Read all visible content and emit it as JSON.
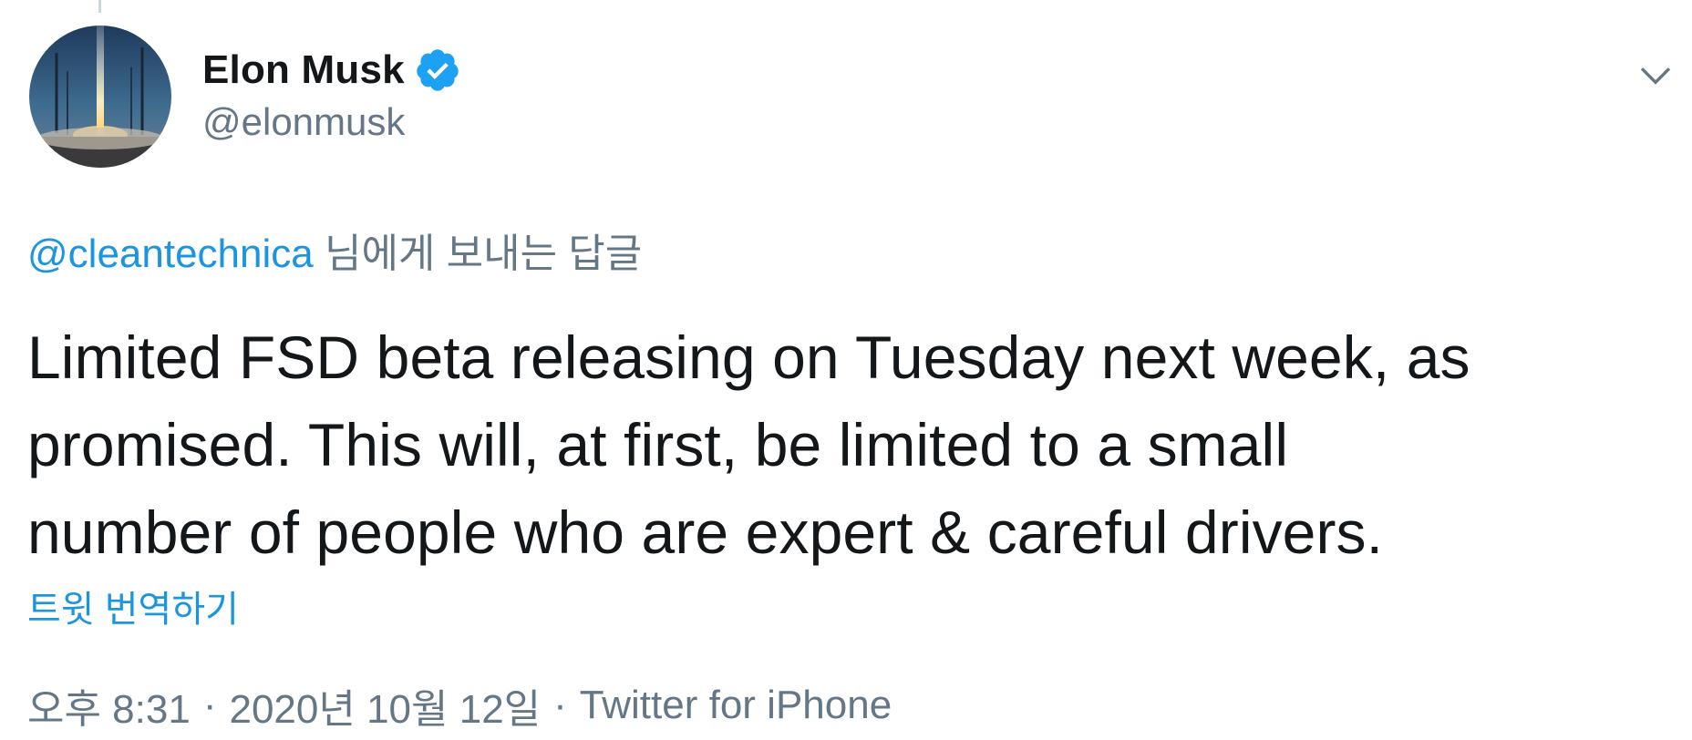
{
  "author": {
    "display_name": "Elon Musk",
    "handle": "@elonmusk",
    "verified": true,
    "avatar_icon": "rocket-launch-avatar"
  },
  "menu": {
    "icon": "chevron-down-icon"
  },
  "reply_context": {
    "mention": "@cleantechnica",
    "suffix": " 님에게 보내는 답글"
  },
  "tweet": {
    "lines": [
      "Limited FSD beta releasing on Tuesday next week, as",
      "promised. This will, at first, be limited to a small",
      "number of people who are expert & careful drivers."
    ],
    "translate_label": "트윗 번역하기"
  },
  "meta": {
    "time": "오후 8:31",
    "separator": "·",
    "date": "2020년 10월 12일",
    "source": "Twitter for iPhone"
  },
  "colors": {
    "link": "#1b95e0",
    "secondary": "#657786",
    "primary_text": "#14171a",
    "verified": "#1da1f2"
  }
}
